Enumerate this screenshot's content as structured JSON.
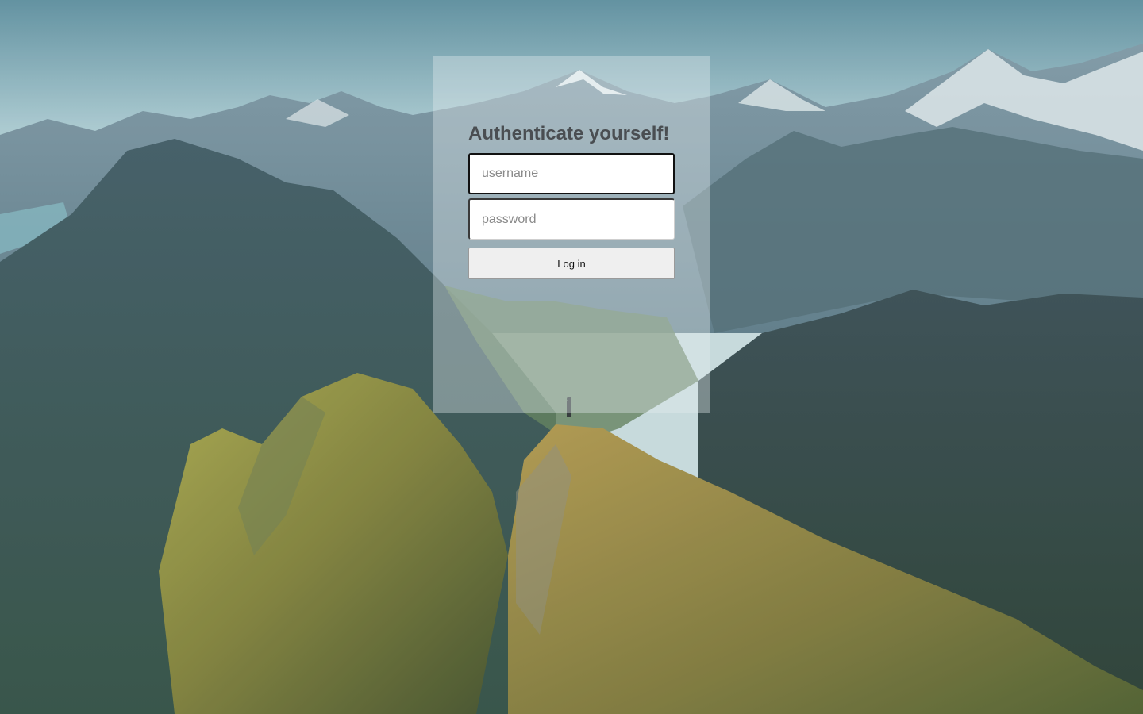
{
  "background": {
    "icon": "mountain-landscape-background",
    "colors": {
      "sky": "#9fc2c9",
      "mountains": "#56707a",
      "grass": "#8a9a3a"
    }
  },
  "login": {
    "title": "Authenticate yourself!",
    "username_placeholder": "username",
    "username_value": "",
    "password_placeholder": "password",
    "password_value": "",
    "login_label": "Log in"
  }
}
